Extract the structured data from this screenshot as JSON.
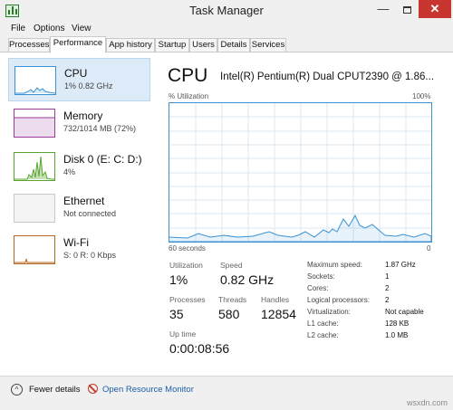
{
  "window": {
    "title": "Task Manager",
    "minimize": "—",
    "close": "✕"
  },
  "menu": {
    "file": "File",
    "options": "Options",
    "view": "View"
  },
  "tabs": [
    "Processes",
    "Performance",
    "App history",
    "Startup",
    "Users",
    "Details",
    "Services"
  ],
  "active_tab": "Performance",
  "sidebar": [
    {
      "name": "CPU",
      "value": "1% 0.82 GHz",
      "color": "#3b92d3"
    },
    {
      "name": "Memory",
      "value": "732/1014 MB (72%)",
      "color": "#9b3c9b"
    },
    {
      "name": "Disk 0 (E: C: D:)",
      "value": "4%",
      "color": "#58a52d"
    },
    {
      "name": "Ethernet",
      "value": "Not connected",
      "color": "#c9c9c9"
    },
    {
      "name": "Wi-Fi",
      "value": "S: 0 R: 0 Kbps",
      "color": "#b5651d"
    }
  ],
  "main": {
    "title": "CPU",
    "processor": "Intel(R) Pentium(R) Dual CPUT2390 @ 1.86...",
    "graph": {
      "ylabel": "% Utilization",
      "ymax": "100%",
      "xlabel_left": "60 seconds",
      "xlabel_right": "0",
      "line_color": "#3b92d3"
    },
    "stats": {
      "utilization_label": "Utilization",
      "utilization": "1%",
      "speed_label": "Speed",
      "speed": "0.82 GHz",
      "processes_label": "Processes",
      "processes": "35",
      "threads_label": "Threads",
      "threads": "580",
      "handles_label": "Handles",
      "handles": "12854",
      "uptime_label": "Up time",
      "uptime": "0:00:08:56"
    },
    "specs": [
      {
        "label": "Maximum speed:",
        "value": "1.87 GHz"
      },
      {
        "label": "Sockets:",
        "value": "1"
      },
      {
        "label": "Cores:",
        "value": "2"
      },
      {
        "label": "Logical processors:",
        "value": "2"
      },
      {
        "label": "Virtualization:",
        "value": "Not capable"
      },
      {
        "label": "L1 cache:",
        "value": "128 KB"
      },
      {
        "label": "L2 cache:",
        "value": "1.0 MB"
      }
    ]
  },
  "footer": {
    "fewer_details": "Fewer details",
    "resource_monitor": "Open Resource Monitor",
    "watermark": "wsxdn.com"
  }
}
